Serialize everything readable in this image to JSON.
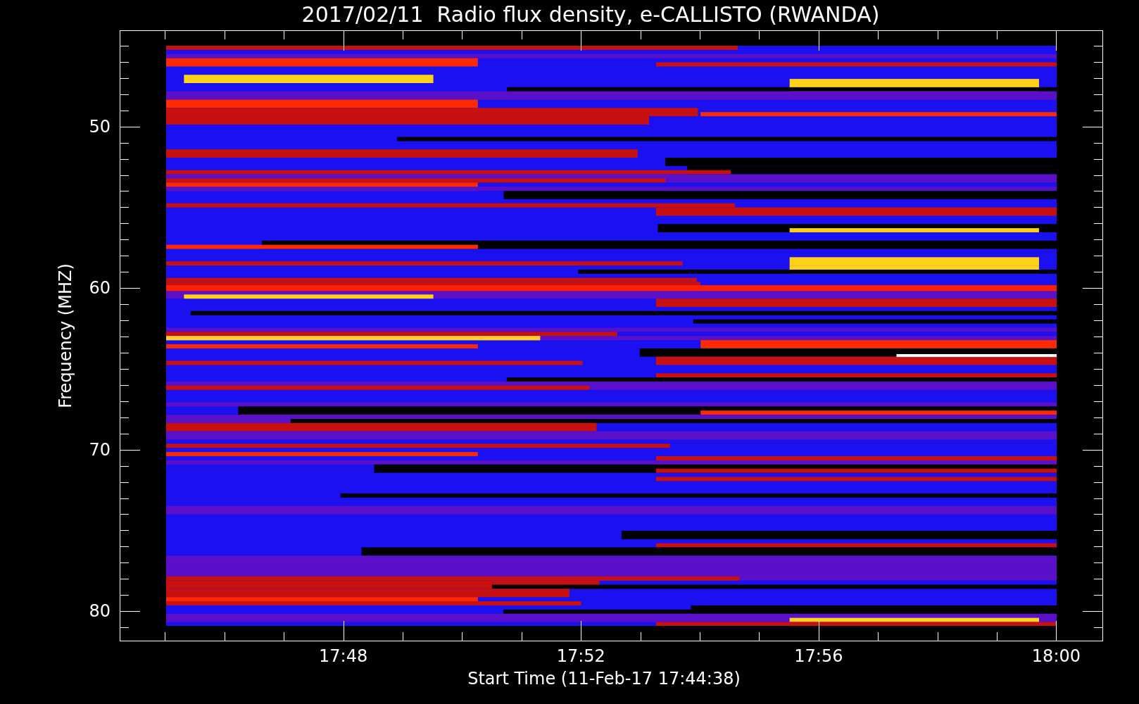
{
  "title": "2017/02/11  Radio flux density, e-CALLISTO (RWANDA)",
  "plot": {
    "ylabel": "Frequency (MHZ)",
    "xlabel": "Start Time (11-Feb-17 17:44:38)",
    "yticks": [
      "50",
      "60",
      "70",
      "80"
    ],
    "xticks": [
      "17:48",
      "17:52",
      "17:56",
      "18:00"
    ]
  }
}
